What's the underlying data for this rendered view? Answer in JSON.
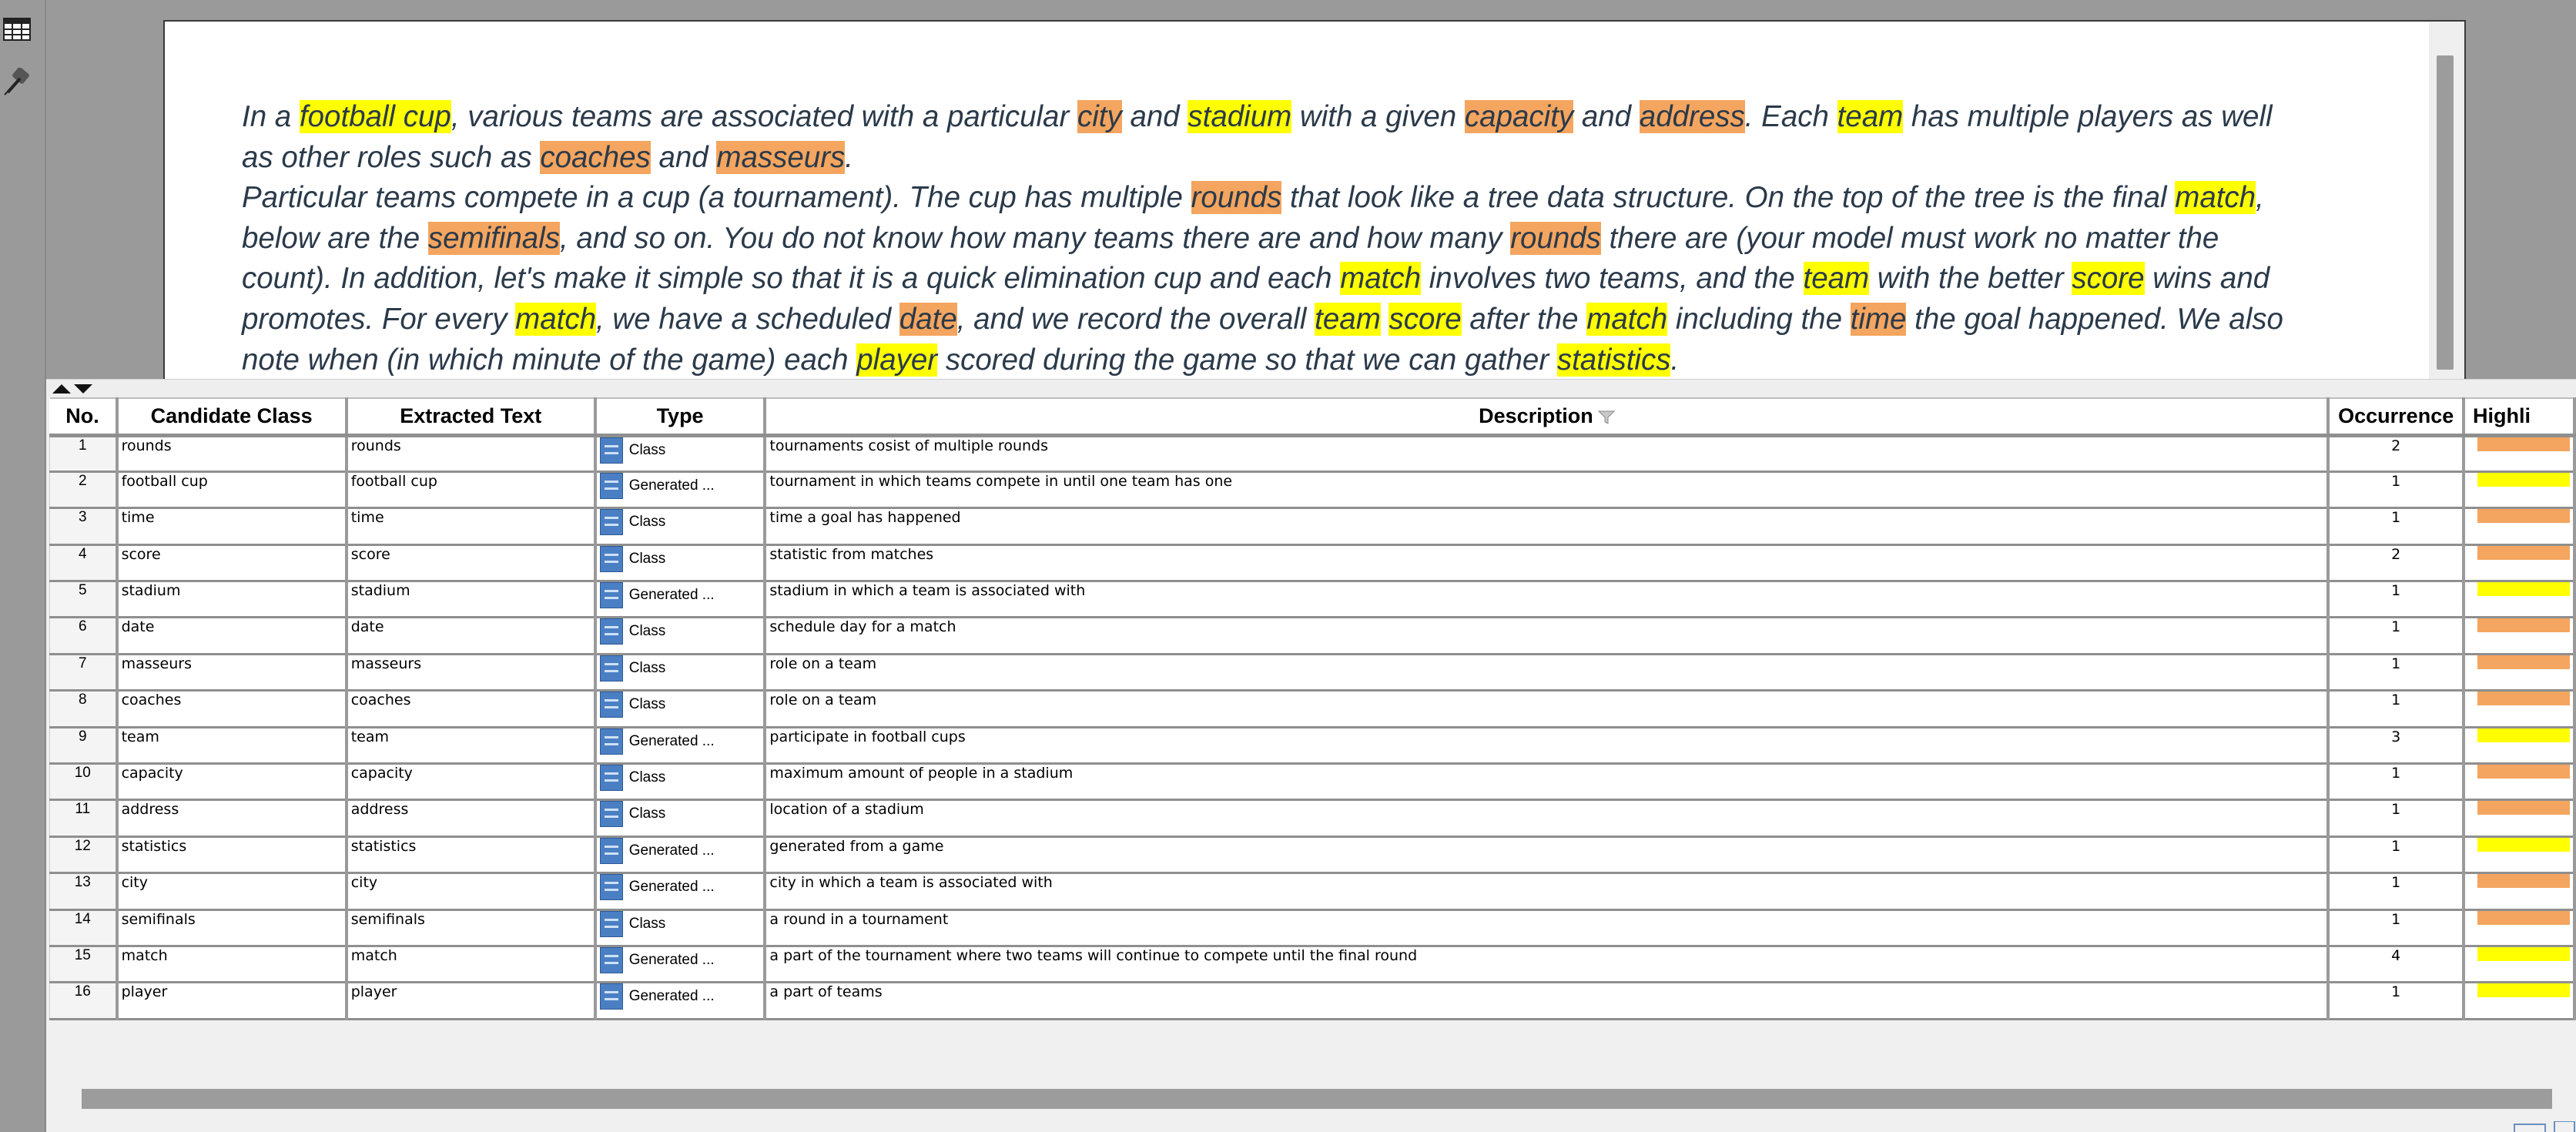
{
  "toolbar": {
    "icons": [
      "table-grid-icon",
      "pen-icon"
    ]
  },
  "document": {
    "lines": [
      [
        [
          "t",
          "In a "
        ],
        [
          "y",
          "football cup"
        ],
        [
          "t",
          ", various teams are associated with a particular "
        ],
        [
          "o",
          "city"
        ],
        [
          "t",
          " and "
        ],
        [
          "y",
          "stadium"
        ],
        [
          "t",
          " with a given "
        ],
        [
          "o",
          "capacity"
        ],
        [
          "t",
          " and "
        ],
        [
          "o",
          "address"
        ],
        [
          "t",
          ". Each "
        ],
        [
          "y",
          "team"
        ],
        [
          "t",
          " has multiple players as well"
        ]
      ],
      [
        [
          "t",
          "as other roles such as "
        ],
        [
          "o",
          "coaches"
        ],
        [
          "t",
          " and "
        ],
        [
          "o",
          "masseurs"
        ],
        [
          "t",
          "."
        ]
      ],
      [
        [
          "t",
          "Particular teams compete in a cup (a tournament). The cup has multiple "
        ],
        [
          "o",
          "rounds"
        ],
        [
          "t",
          " that look like a tree data structure. On the top of the tree is the final "
        ],
        [
          "y",
          "match"
        ],
        [
          "t",
          ","
        ]
      ],
      [
        [
          "t",
          "below are the "
        ],
        [
          "o",
          "semifinals"
        ],
        [
          "t",
          ", and so on. You do not know how many teams there are and how many "
        ],
        [
          "o",
          "rounds"
        ],
        [
          "t",
          " there are (your model must work no matter the"
        ]
      ],
      [
        [
          "t",
          "count). In addition, let's make it simple so that it is a quick elimination cup and each "
        ],
        [
          "y",
          "match"
        ],
        [
          "t",
          " involves two teams, and the "
        ],
        [
          "y",
          "team"
        ],
        [
          "t",
          " with the better "
        ],
        [
          "y",
          "score"
        ],
        [
          "t",
          " wins and"
        ]
      ],
      [
        [
          "t",
          "promotes. For every "
        ],
        [
          "y",
          "match"
        ],
        [
          "t",
          ", we have a scheduled "
        ],
        [
          "o",
          "date"
        ],
        [
          "t",
          ", and we record the overall "
        ],
        [
          "y",
          "team"
        ],
        [
          "t",
          " "
        ],
        [
          "y",
          "score"
        ],
        [
          "t",
          " after the "
        ],
        [
          "y",
          "match"
        ],
        [
          "t",
          " including the "
        ],
        [
          "o",
          "time"
        ],
        [
          "t",
          " the goal happened. We also"
        ]
      ],
      [
        [
          "t",
          "note when (in which minute of the game) each "
        ],
        [
          "y",
          "player"
        ],
        [
          "t",
          " scored during the game so that we can gather "
        ],
        [
          "y",
          "statistics"
        ],
        [
          "t",
          "."
        ]
      ]
    ],
    "highlight_colors": {
      "class": "#f4a55f",
      "generated": "#ffff00"
    }
  },
  "table": {
    "columns": [
      {
        "label": "No."
      },
      {
        "label": "Candidate Class"
      },
      {
        "label": "Extracted Text"
      },
      {
        "label": "Type"
      },
      {
        "label": "Description"
      },
      {
        "label": "Occurrence"
      },
      {
        "label": "Highli"
      }
    ],
    "rows": [
      {
        "no": "1",
        "candidate": "rounds",
        "extracted": "rounds",
        "type": "Class",
        "description": "tournaments cosist of multiple rounds",
        "occurrence": "2",
        "color": "#f4a55f"
      },
      {
        "no": "2",
        "candidate": "football cup",
        "extracted": "football cup",
        "type": "Generated ...",
        "description": "tournament in which teams compete in until one team has one",
        "occurrence": "1",
        "color": "#ffff00"
      },
      {
        "no": "3",
        "candidate": "time",
        "extracted": "time",
        "type": "Class",
        "description": "time a goal has happened",
        "occurrence": "1",
        "color": "#f4a55f"
      },
      {
        "no": "4",
        "candidate": "score",
        "extracted": "score",
        "type": "Class",
        "description": "statistic from matches",
        "occurrence": "2",
        "color": "#f4a55f"
      },
      {
        "no": "5",
        "candidate": "stadium",
        "extracted": "stadium",
        "type": "Generated ...",
        "description": "stadium in which a team is associated with",
        "occurrence": "1",
        "color": "#ffff00"
      },
      {
        "no": "6",
        "candidate": "date",
        "extracted": "date",
        "type": "Class",
        "description": "schedule day for a match",
        "occurrence": "1",
        "color": "#f4a55f"
      },
      {
        "no": "7",
        "candidate": "masseurs",
        "extracted": "masseurs",
        "type": "Class",
        "description": "role on a team",
        "occurrence": "1",
        "color": "#f4a55f"
      },
      {
        "no": "8",
        "candidate": "coaches",
        "extracted": "coaches",
        "type": "Class",
        "description": "role on a team",
        "occurrence": "1",
        "color": "#f4a55f"
      },
      {
        "no": "9",
        "candidate": "team",
        "extracted": "team",
        "type": "Generated ...",
        "description": "participate in football cups",
        "occurrence": "3",
        "color": "#ffff00"
      },
      {
        "no": "10",
        "candidate": "capacity",
        "extracted": "capacity",
        "type": "Class",
        "description": "maximum amount of people in a stadium",
        "occurrence": "1",
        "color": "#f4a55f"
      },
      {
        "no": "11",
        "candidate": "address",
        "extracted": "address",
        "type": "Class",
        "description": "location of a stadium",
        "occurrence": "1",
        "color": "#f4a55f"
      },
      {
        "no": "12",
        "candidate": "statistics",
        "extracted": "statistics",
        "type": "Generated ...",
        "description": "generated from a game",
        "occurrence": "1",
        "color": "#ffff00"
      },
      {
        "no": "13",
        "candidate": "city",
        "extracted": "city",
        "type": "Generated ...",
        "description": "city in which a team is associated with",
        "occurrence": "1",
        "color": "#f4a55f"
      },
      {
        "no": "14",
        "candidate": "semifinals",
        "extracted": "semifinals",
        "type": "Class",
        "description": "a round in a tournament",
        "occurrence": "1",
        "color": "#f4a55f"
      },
      {
        "no": "15",
        "candidate": "match",
        "extracted": "match",
        "type": "Generated ...",
        "description": "a part of the tournament where two teams will continue to compete until the final round",
        "occurrence": "4",
        "color": "#ffff00"
      },
      {
        "no": "16",
        "candidate": "player",
        "extracted": "player",
        "type": "Generated ...",
        "description": "a part of teams",
        "occurrence": "1",
        "color": "#ffff00"
      }
    ]
  }
}
